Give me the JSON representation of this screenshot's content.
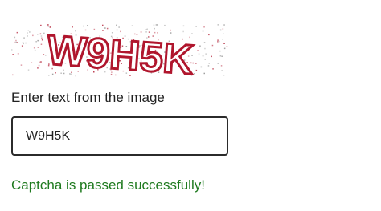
{
  "captcha": {
    "image_text": "W9H5K",
    "text_color": "#b0162d",
    "noise_color": "#8a8a8a"
  },
  "form": {
    "prompt_label": "Enter text from the image",
    "input_value": "W9H5K"
  },
  "status": {
    "message": "Captcha is passed successfully!",
    "color": "#1f7a1f"
  }
}
